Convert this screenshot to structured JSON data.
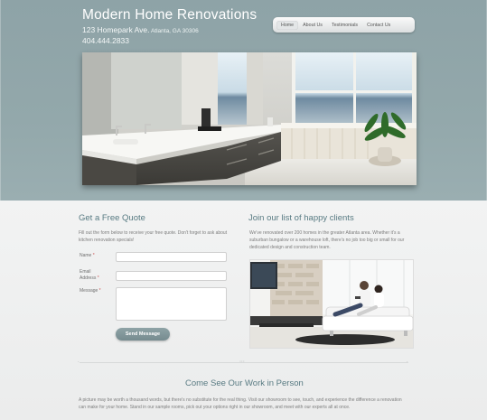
{
  "header": {
    "title": "Modern Home Renovations",
    "address_street": "123 Homepark Ave.",
    "address_city": " Atlanta, GA 30306",
    "phone": "404.444.2833"
  },
  "nav": {
    "items": [
      {
        "label": "Home",
        "active": true
      },
      {
        "label": "About Us",
        "active": false
      },
      {
        "label": "Testimonials",
        "active": false
      },
      {
        "label": "Contact Us",
        "active": false
      }
    ]
  },
  "quote": {
    "heading": "Get a Free Quote",
    "intro": "Fill out the form below to receive your free quote. Don't forget to ask about kitchen renovation specials!",
    "fields": {
      "name_label": "Name",
      "email_label_1": "Email",
      "email_label_2": "Address",
      "message_label": "Message",
      "required_mark": " *"
    },
    "submit_label": "Send Message"
  },
  "clients": {
    "heading": "Join our list of happy clients",
    "intro": "We've renovated over 200 homes in the greater Atlanta area. Whether it's a suburban bungalow or a warehouse loft, there's no job too big or small for our dedicated design and construction team."
  },
  "showroom": {
    "heading": "Come See Our Work in Person",
    "text": "A picture may be worth a thousand words, but there's no substitute for the real thing. Visit our showroom to see, touch, and experience the difference a renovation can make for your home. Stand in our sample rooms, pick out your options right in our showroom, and meet with our experts all at once."
  },
  "colors": {
    "header_bg": "#93a8ab",
    "heading_accent": "#587a82",
    "button_bg": "#7f9498"
  }
}
